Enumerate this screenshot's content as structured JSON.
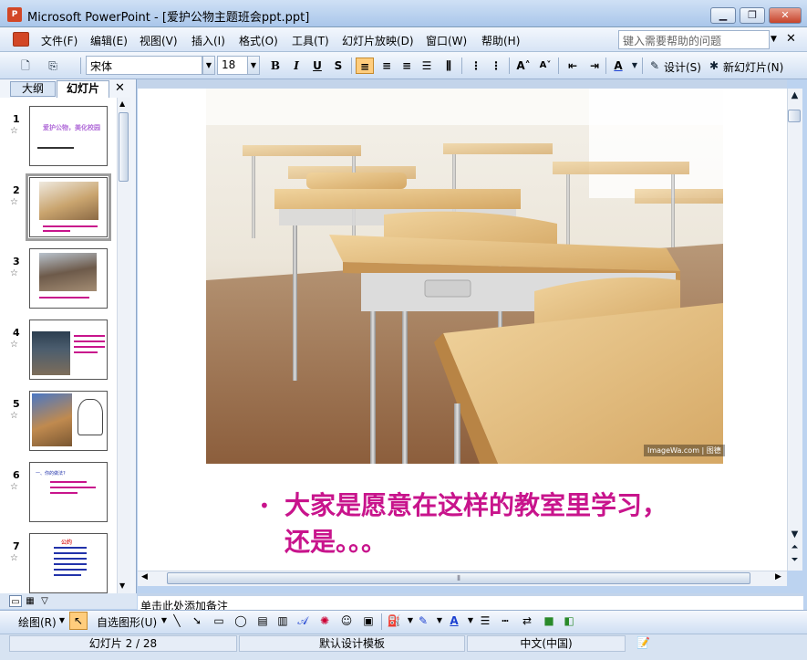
{
  "window": {
    "title": "Microsoft PowerPoint - [爱护公物主题班会ppt.ppt]",
    "icon": "powerpoint-app-icon",
    "min_label": "▁",
    "max_label": "❐",
    "close_label": "✕"
  },
  "menu": {
    "items": [
      "文件(F)",
      "编辑(E)",
      "视图(V)",
      "插入(I)",
      "格式(O)",
      "工具(T)",
      "幻灯片放映(D)",
      "窗口(W)",
      "帮助(H)"
    ],
    "help_placeholder": "键入需要帮助的问题",
    "close_label": "✕"
  },
  "toolbar": {
    "font_name": "宋体",
    "font_size": "18",
    "bold": "B",
    "italic": "I",
    "underline": "U",
    "shadow": "S",
    "design_label": "设计(S)",
    "new_slide_label": "新幻灯片(N)"
  },
  "pane": {
    "tab_outline": "大纲",
    "tab_slides": "幻灯片",
    "close_label": "✕",
    "slides": [
      {
        "num": "1",
        "title": "爱护公物，美化校园"
      },
      {
        "num": "2"
      },
      {
        "num": "3"
      },
      {
        "num": "4"
      },
      {
        "num": "5"
      },
      {
        "num": "6",
        "title": "一、你的做法?"
      },
      {
        "num": "7",
        "title": "公约"
      }
    ],
    "selected_slide": 2
  },
  "slide": {
    "photo_credit": "ImageWa.com | 图德",
    "bullet": "•",
    "bullet_text": "大家是愿意在这样的教室里学习，还是。。。",
    "text_color": "#c8148c"
  },
  "notes": {
    "placeholder": "单击此处添加备注"
  },
  "drawing": {
    "draw_label": "绘图(R)",
    "autoshape_label": "自选图形(U)"
  },
  "status": {
    "slide_info": "幻灯片 2 / 28",
    "template": "默认设计模板",
    "language": "中文(中国)"
  }
}
